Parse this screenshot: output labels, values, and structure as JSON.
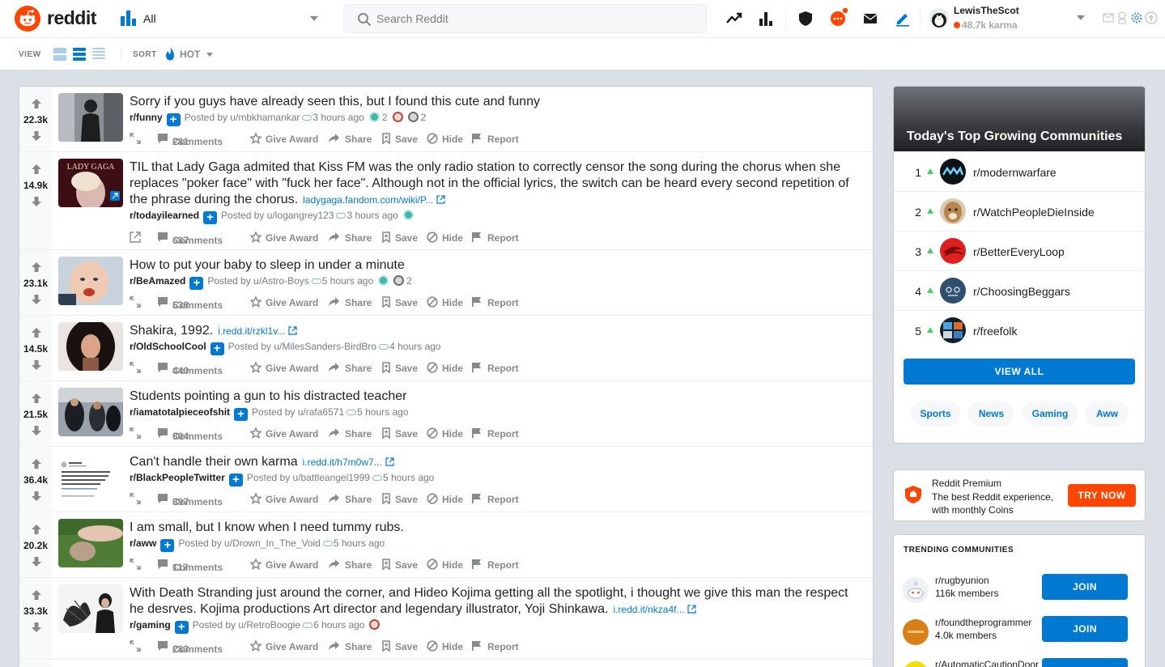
{
  "header": {
    "brand": "reddit",
    "feed_label": "All",
    "search_placeholder": "Search Reddit",
    "icons": [
      "trending-icon",
      "stats-icon",
      "shield-icon",
      "chat-icon",
      "mail-icon",
      "pencil-icon"
    ],
    "user": {
      "name": "LewisTheScot",
      "karma": "48.7k karma"
    }
  },
  "subbar": {
    "view_label": "VIEW",
    "sort_label": "SORT",
    "sort_value": "HOT"
  },
  "colors": {
    "accent": "#0079d3",
    "brand": "#ff4500",
    "upvote_green": "#46d160"
  },
  "actions": {
    "comments_suffix": "Comments",
    "give_award": "Give Award",
    "share": "Share",
    "save": "Save",
    "hide": "Hide",
    "report": "Report"
  },
  "posts": [
    {
      "score": "22.3k",
      "title": "Sorry if you guys have already seen this, but I found this cute and funny",
      "link": "",
      "subreddit": "r/funny",
      "posted_by": "Posted by u/mbkhamankar",
      "age": "3 hours ago",
      "awards": [
        "2",
        "",
        "2"
      ],
      "comments": "281"
    },
    {
      "score": "14.9k",
      "title": "TIL that Lady Gaga admited that Kiss FM was the only radio station to correctly censor the song during the chorus when she replaces \"poker face\" with \"fuck her face\". Although not in the official lyrics, the switch can be heard every second repetition of the phrase during the chorus.",
      "link": "ladygaga.fandom.com/wiki/P...",
      "subreddit": "r/todayilearned",
      "posted_by": "Posted by u/logangrey123",
      "age": "3 hours ago",
      "awards": [
        ""
      ],
      "comments": "687"
    },
    {
      "score": "23.1k",
      "title": "How to put your baby to sleep in under a minute",
      "link": "",
      "subreddit": "r/BeAmazed",
      "posted_by": "Posted by u/Astro-Boys",
      "age": "5 hours ago",
      "awards": [
        "",
        "2"
      ],
      "comments": "538"
    },
    {
      "score": "14.5k",
      "title": "Shakira, 1992.",
      "link": "i.redd.it/rzkl1v...",
      "subreddit": "r/OldSchoolCool",
      "posted_by": "Posted by u/MilesSanders-BirdBro",
      "age": "4 hours ago",
      "awards": [],
      "comments": "440"
    },
    {
      "score": "21.5k",
      "title": "Students pointing a gun to his distracted teacher",
      "link": "",
      "subreddit": "r/iamatotalpieceofshit",
      "posted_by": "Posted by u/rafa6571",
      "age": "5 hours ago",
      "awards": [],
      "comments": "804"
    },
    {
      "score": "36.4k",
      "title": "Can't handle their own karma",
      "link": "i.redd.it/h7m0w7...",
      "subreddit": "r/BlackPeopleTwitter",
      "posted_by": "Posted by u/battleangel1999",
      "age": "5 hours ago",
      "awards": [],
      "comments": "397"
    },
    {
      "score": "20.2k",
      "title": "I am small, but I know when I need tummy rubs.",
      "link": "",
      "subreddit": "r/aww",
      "posted_by": "Posted by u/Drown_In_The_Void",
      "age": "5 hours ago",
      "awards": [],
      "comments": "117"
    },
    {
      "score": "33.3k",
      "title": "With Death Stranding just around the corner, and Hideo Kojima getting all the spotlight, i thought we give this man the respect he desrves. Kojima productions Art director and legendary illustrator, Yoji Shinkawa.",
      "link": "i.redd.it/nkza4f...",
      "subreddit": "r/gaming",
      "posted_by": "Posted by u/RetroBoogie",
      "age": "6 hours ago",
      "awards": [
        ""
      ],
      "comments": "283"
    }
  ],
  "growing": {
    "title": "Today's Top Growing Communities",
    "items": [
      {
        "rank": "1",
        "name": "r/modernwarfare"
      },
      {
        "rank": "2",
        "name": "r/WatchPeopleDieInside"
      },
      {
        "rank": "3",
        "name": "r/BetterEveryLoop"
      },
      {
        "rank": "4",
        "name": "r/ChoosingBeggars"
      },
      {
        "rank": "5",
        "name": "r/freefolk"
      }
    ],
    "view_all": "VIEW ALL",
    "chips": [
      "Sports",
      "News",
      "Gaming",
      "Aww"
    ]
  },
  "premium": {
    "title": "Reddit Premium",
    "desc": "The best Reddit experience, with monthly Coins",
    "button": "TRY NOW"
  },
  "trending": {
    "title": "TRENDING COMMUNITIES",
    "join_label": "JOIN",
    "items": [
      {
        "name": "r/rugbyunion",
        "members": "116k members"
      },
      {
        "name": "r/foundtheprogrammer",
        "members": "4.0k members"
      },
      {
        "name": "r/AutomaticCautionDoor",
        "members": ""
      }
    ]
  }
}
